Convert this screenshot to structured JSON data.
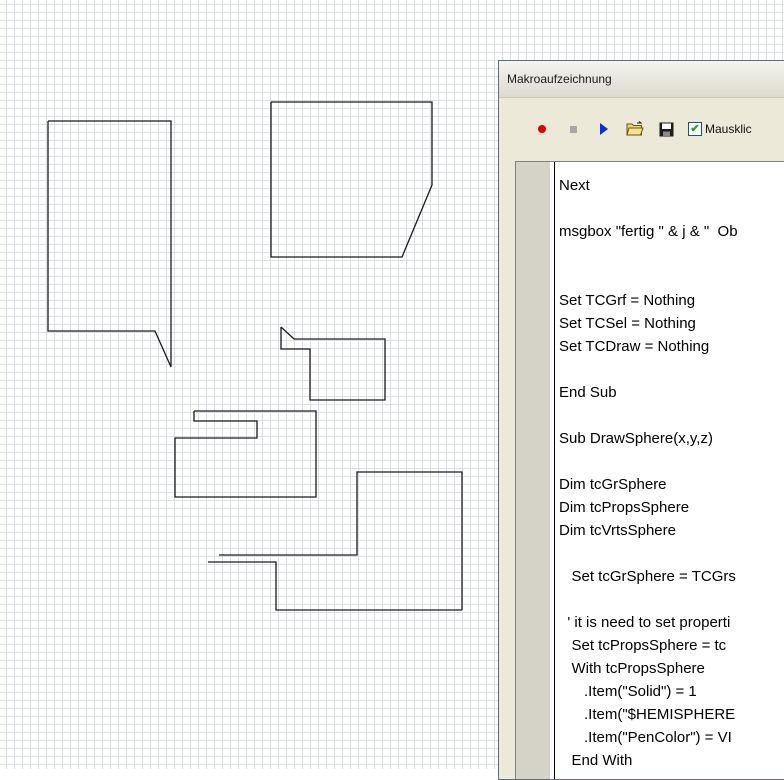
{
  "window": {
    "title": "Makroaufzeichnung",
    "checkbox_label": "Mausklic",
    "checkbox_checked": true
  },
  "toolbar": {
    "icons": [
      "record-icon",
      "stop-icon",
      "play-icon",
      "open-folder-icon",
      "save-icon"
    ]
  },
  "editor": {
    "lines": [
      "Next",
      "",
      "msgbox \"fertig \" & j & \"  Ob",
      "",
      "",
      "Set TCGrf = Nothing",
      "Set TCSel = Nothing",
      "Set TCDraw = Nothing",
      "",
      "End Sub",
      "",
      "Sub DrawSphere(x,y,z)",
      "",
      "Dim tcGrSphere",
      "Dim tcPropsSphere",
      "Dim tcVrtsSphere",
      "",
      "   Set tcGrSphere = TCGrs",
      "",
      "  ' it is need to set properti",
      "   Set tcPropsSphere = tc",
      "   With tcPropsSphere",
      "      .Item(\"Solid\") = 1",
      "      .Item(\"$HEMISPHERE",
      "      .Item(\"PenColor\") = VI",
      "   End With"
    ]
  },
  "colors": {
    "canvas_grid": "#d9dcec",
    "record": "#e00000",
    "play": "#0a2fd4"
  }
}
